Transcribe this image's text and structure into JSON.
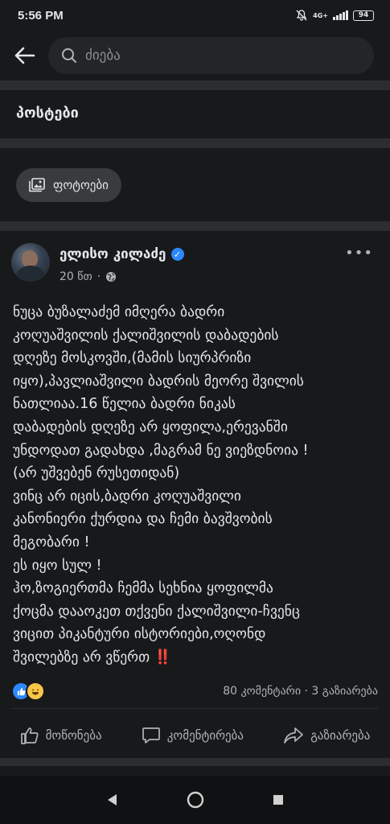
{
  "status_bar": {
    "time": "5:56 PM",
    "network_label": "4G+",
    "battery": "94",
    "icons": [
      "mute-icon",
      "signal-icon",
      "battery-icon"
    ]
  },
  "search": {
    "placeholder": "ძიება",
    "icons": [
      "back-arrow-icon",
      "search-icon"
    ]
  },
  "section": {
    "title": "პოსტები"
  },
  "filter_chip": {
    "label": "ფოტოები",
    "icon": "photo-icon"
  },
  "post": {
    "author": "ელისო კილაძე",
    "verified": true,
    "time": "20 წთ",
    "separator": "·",
    "privacy_icon": "globe-icon",
    "body": "ნუცა ბუზალაძემ იმღერა ბადრი\nკოღუაშვილის ქალიშვილის დაბადების\nდღეზე მოსკოვში,(მამის სიურპრიზი\nიყო),პავლიაშვილი ბადრის მეორე შვილის\nნათლიაა.16 წელია ბადრი ნიკას\nდაბადების დღეზე არ ყოფილა,ერევანში\nუნდოდათ გადახდა ,მაგრამ ნე ვიეზდნოია !\n(არ უშვებენ რუსეთიდან)\nვინც არ იცის,ბადრი კოღუაშვილი\nკანონიერი ქურდია და ჩემი ბავშვობის\nმეგობარი !\nეს იყო სულ !\nჰო,ზოგიერთმა ჩემმა სეხნია ყოფილმა\nქოცმა დააოკეთ თქვენი ქალიშვილი-ჩვენც\nვიცით პიკანტური ისტორიები,ოღონდ\nშვილებზე არ ვწერთ",
    "emoji": "‼️",
    "reactions": [
      "like",
      "haha"
    ],
    "comments": "80 კომენტარი",
    "shares": "3 გაზიარება",
    "stats_separator": "·"
  },
  "actions": {
    "like": "მოწონება",
    "comment": "კომენტირება",
    "share": "გაზიარება"
  },
  "colors": {
    "background": "#18191a",
    "divider": "#2c2d2f",
    "accent": "#2d88ff",
    "secondary_text": "#b0b3b8"
  }
}
